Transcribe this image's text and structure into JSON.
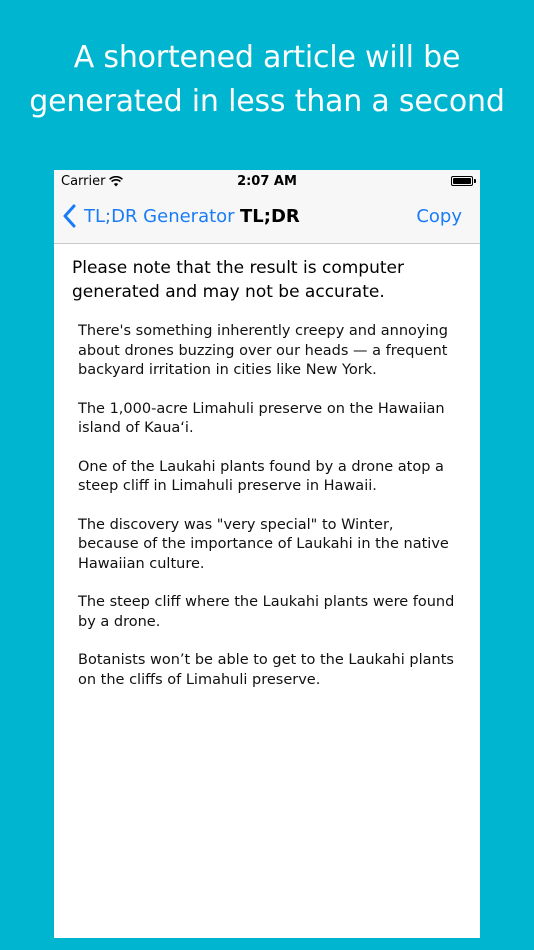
{
  "headline": {
    "line1": "A shortened article will be",
    "line2": "generated in less than a second"
  },
  "status_bar": {
    "carrier": "Carrier",
    "time": "2:07 AM",
    "battery_level": 1.0
  },
  "nav": {
    "back_label": "TL;DR Generator",
    "title": "TL;DR",
    "copy_label": "Copy"
  },
  "notice": "Please note that the result is computer generated and may not be accurate.",
  "paragraphs": [
    "There's something inherently creepy and annoying about drones buzzing over our heads — a frequent backyard irritation in cities like New York.",
    "The 1,000-acre Limahuli preserve on the Hawaiian island of Kaua‘i.",
    "One of the Laukahi plants found by a drone atop a steep cliff in Limahuli preserve in Hawaii.",
    "The discovery was \"very special\" to Winter, because of the importance of Laukahi in the native Hawaiian culture.",
    "The steep cliff where the Laukahi plants were found by a drone.",
    "Botanists won’t be able to get to the Laukahi plants on the cliffs of Limahuli preserve."
  ],
  "colors": {
    "background": "#00b5cf",
    "ios_blue": "#1a7cf5",
    "bar_background": "#f7f7f7"
  },
  "icons": {
    "wifi": "wifi-icon",
    "battery": "battery-icon",
    "back": "chevron-left-icon"
  }
}
